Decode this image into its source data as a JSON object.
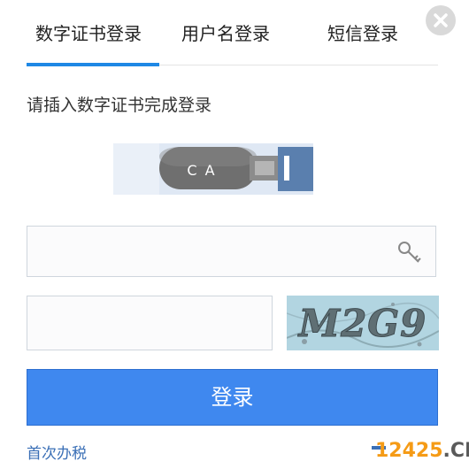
{
  "tabs": [
    {
      "label": "数字证书登录",
      "active": true
    },
    {
      "label": "用户名登录",
      "active": false
    },
    {
      "label": "短信登录",
      "active": false
    }
  ],
  "close": {
    "icon": "close-icon"
  },
  "prompt": "请插入数字证书完成登录",
  "ca_device": {
    "label": "C A",
    "icon": "usb-key-icon"
  },
  "pin_field": {
    "value": "",
    "placeholder": "",
    "icon": "key-icon"
  },
  "captcha": {
    "input_value": "",
    "image_text": "M2G9"
  },
  "login_button": "登录",
  "first_time_link": "首次办税",
  "watermark": {
    "number": "12425",
    "suffix": ".CN"
  },
  "colors": {
    "accent": "#1e88e5",
    "button": "#3f88ef",
    "link": "#3a6fb6",
    "watermark_number": "#f59b16"
  }
}
